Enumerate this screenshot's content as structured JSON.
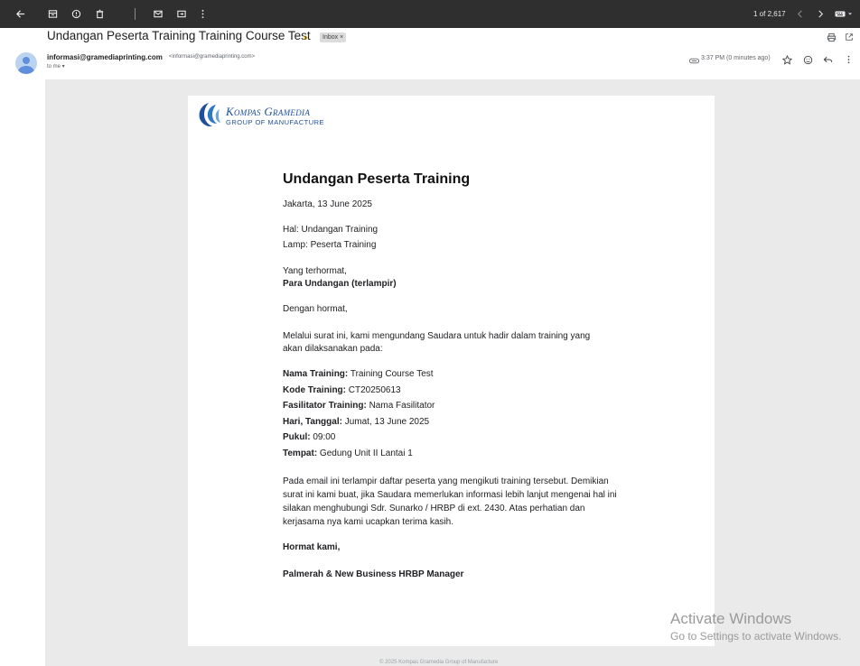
{
  "toolbar": {
    "pager": "1 of 2,617"
  },
  "subject": {
    "title": "Undangan Peserta Training Training Course Test",
    "importance": "»",
    "label": "Inbox ×"
  },
  "sender": {
    "name": "informasi@gramediaprinting.com",
    "email": "<informasi@gramediaprinting.com>",
    "to": "to me ▾",
    "time": "3:37 PM (0 minutes ago)"
  },
  "logo": {
    "line1": "Kompas Gramedia",
    "line2": "GROUP OF MANUFACTURE"
  },
  "letter": {
    "title": "Undangan Peserta Training",
    "date": "Jakarta, 13 June 2025",
    "hal": "Hal: Undangan Training",
    "lamp": "Lamp: Peserta Training",
    "greeting": "Yang terhormat,",
    "recipient": "Para Undangan (terlampir)",
    "salutation": "Dengan hormat,",
    "intro": "Melalui surat ini, kami mengundang Saudara untuk hadir dalam training yang akan dilaksanakan pada:",
    "details": [
      {
        "label": "Nama Training:",
        "value": " Training Course Test"
      },
      {
        "label": "Kode Training:",
        "value": " CT20250613"
      },
      {
        "label": "Fasilitator Training:",
        "value": " Nama Fasilitator"
      },
      {
        "label": "Hari, Tanggal:",
        "value": " Jumat, 13 June 2025"
      },
      {
        "label": "Pukul:",
        "value": " 09:00"
      },
      {
        "label": "Tempat:",
        "value": " Gedung Unit II Lantai 1"
      }
    ],
    "closing_para": "Pada email ini terlampir daftar peserta yang mengikuti training tersebut. Demikian surat ini kami buat, jika Saudara memerlukan informasi lebih lanjut mengenai hal ini silakan menghubungi Sdr. Sunarko / HRBP di ext. 2430. Atas perhatian dan kerjasama nya kami ucapkan terima kasih.",
    "regards": "Hormat kami,",
    "signature": "Palmerah & New Business HRBP Manager"
  },
  "footer": {
    "text": "© 2025 Kompas Gramedia Group of Manufacture"
  },
  "watermark": {
    "line1": "Activate Windows",
    "line2": "Go to Settings to activate Windows."
  },
  "colors": {
    "toolbar_bg": "#2f2f2f",
    "email_bg": "#eaeaea",
    "logo_blue": "#1d4f9c",
    "importance": "#f4b400"
  },
  "icons": {
    "back": "arrow-left-icon",
    "archive": "archive-icon",
    "spam": "report-spam-icon",
    "delete": "trash-icon",
    "unread": "mark-unread-icon",
    "move": "move-to-icon",
    "more": "more-vert-icon",
    "print": "print-icon",
    "popout": "open-in-new-icon",
    "attachment": "attachment-icon",
    "star": "star-icon",
    "emoji": "emoji-icon",
    "reply": "reply-icon"
  }
}
